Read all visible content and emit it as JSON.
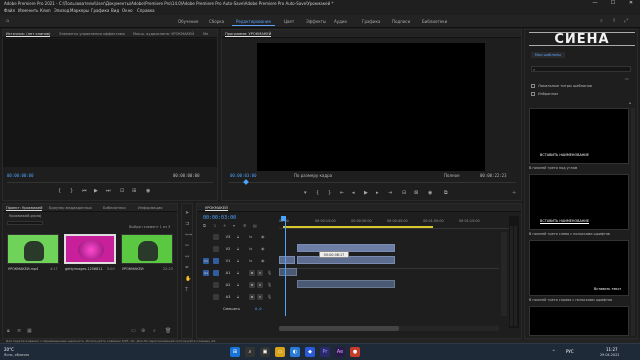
{
  "window": {
    "title": "Adobe Premiere Pro 2021 - C:\\Пользователи\\User\\Документы\\Adobe\\Premiere Pro\\14.0\\Adobe Premiere Pro Auto-Save\\Adobe Premiere Pro Auto-Save\\Урокмакей *",
    "minimize": "—",
    "maximize": "☐",
    "close": "✕"
  },
  "menu": [
    "Файл",
    "Изменить",
    "Клип",
    "Эпизод",
    "Маркеры",
    "Графика",
    "Вид",
    "Окно",
    "Справка"
  ],
  "workspaces": [
    "Обучение",
    "Сборка",
    "Редактирование",
    "Цвет",
    "Эффекты",
    "Аудио",
    "Графика",
    "Подписи",
    "Библиотеки"
  ],
  "workspace_active_index": 2,
  "source_panel": {
    "tabs": [
      "Источник: (нет клипов)",
      "Элементы управления эффектами",
      "Микш. аудиоклипа: УРОКМАКЕЙ",
      "Ме"
    ],
    "timecode_left": "00:00:00:00",
    "timecode_right": "00:00:00:00"
  },
  "program_panel": {
    "title": "Программа: УРОКМАКЕЙ",
    "timecode_left": "00:00:03:00",
    "fit": "По размеру кадра",
    "quality": "Полное",
    "timecode_right": "00:00:22:23"
  },
  "project_panel": {
    "tabs": [
      "Проект: Урокмакей",
      "Браузер медиаданных",
      "Библиотеки",
      "Информация"
    ],
    "file": "Урокмакей.prproj",
    "selection": "Выбран элемент 1 из 3",
    "items": [
      {
        "name": "УРОКМАКЕЙ.mp4",
        "duration": "4:17",
        "color": "#6fd35a"
      },
      {
        "name": "gettyimages-1256811.jpg",
        "duration": "5:00",
        "color": "#c8209a"
      },
      {
        "name": "УРОКМАКЕЙ",
        "duration": "22:23",
        "color": "#5ac840"
      }
    ]
  },
  "timeline": {
    "title": "УРОКМАКЕЙ",
    "timecode": "00:00:03:00",
    "ruler": [
      "00:00",
      "00:00:15:00",
      "00:00:30:00",
      "00:00:45:00",
      "00:01:00:00",
      "00:01:15:00"
    ],
    "tracks": [
      "V3",
      "V2",
      "V1",
      "A1",
      "A2",
      "A3"
    ],
    "master_label": "Смешать",
    "master_value": "0,0",
    "tooltip": "00:00:08:17"
  },
  "graphics_panel": {
    "logo": "СИЕНА",
    "tab": "Мои шаблоны",
    "search_placeholder": "",
    "checkbox1": "Локальные титры шаблонов",
    "checkbox2": "Избранное",
    "templates": [
      {
        "label": "В нижней трети под углом",
        "caption": "ВСТАВИТЬ НАИМЕНОВАНИЕ"
      },
      {
        "label": "В нижней трети слева с полосками шрифтов",
        "caption": "ВСТАВИТЬ НАИМЕНОВАНИЕ"
      },
      {
        "label": "В нижней трети справа с полосками шрифтов",
        "caption": "Вставить текст"
      },
      {
        "label": "",
        "caption": ""
      }
    ]
  },
  "status_bar": "Для перетаскивания с перемещением щелкните. Используйте клавиши Shift, Alt. Для Alt-перетаскивания используйте клавишу Alt.",
  "taskbar": {
    "weather_temp": "20°C",
    "weather_desc": "Ясно, облачно",
    "lang": "РУС",
    "time": "11:27",
    "date": "29.04.2022"
  }
}
